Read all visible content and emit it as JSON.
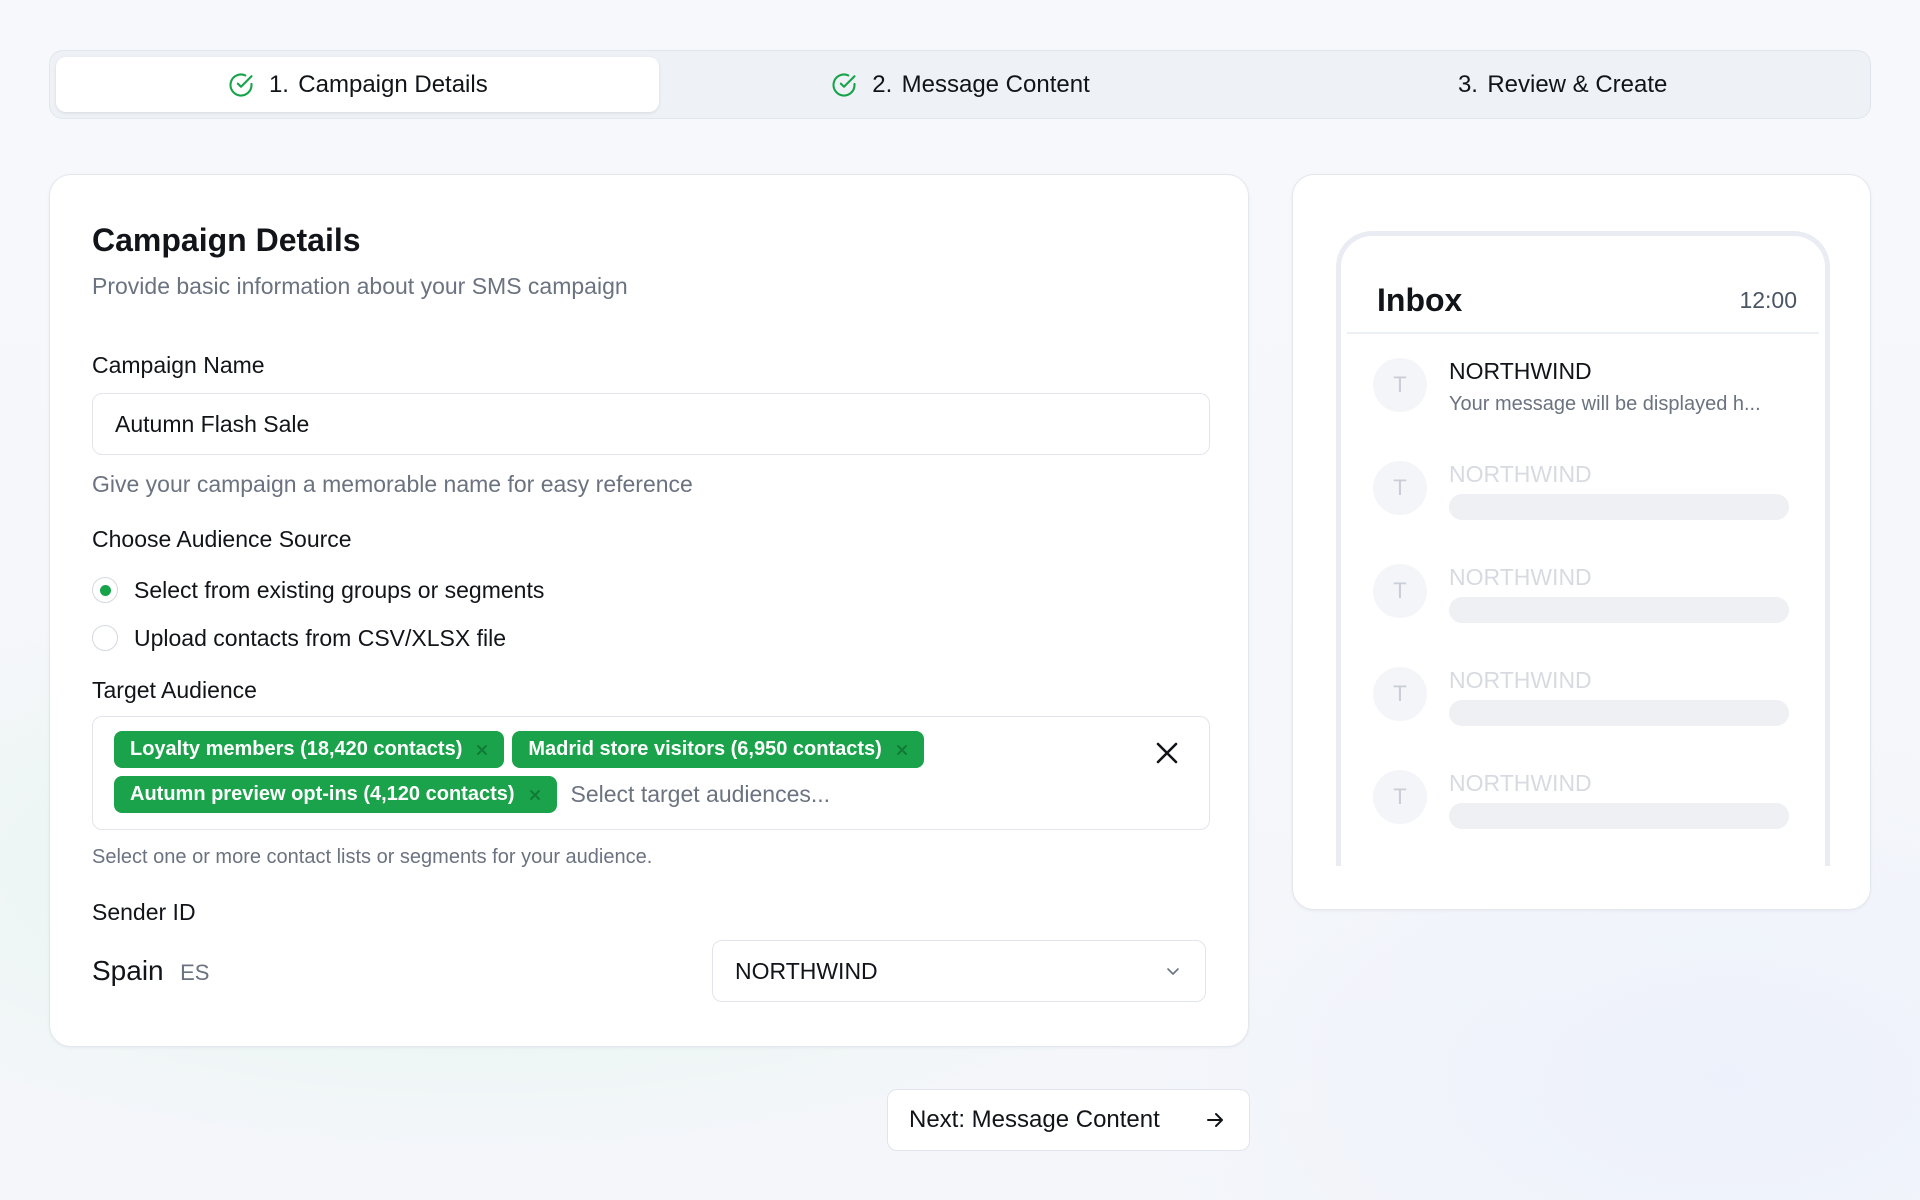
{
  "stepper": {
    "steps": [
      {
        "number": "1.",
        "label": "Campaign Details",
        "completed": true,
        "active": true
      },
      {
        "number": "2.",
        "label": "Message Content",
        "completed": true,
        "active": false
      },
      {
        "number": "3.",
        "label": "Review & Create",
        "completed": false,
        "active": false
      }
    ]
  },
  "details": {
    "title": "Campaign Details",
    "subtitle": "Provide basic information about your SMS campaign",
    "campaign_name": {
      "label": "Campaign Name",
      "value": "Autumn Flash Sale",
      "helper": "Give your campaign a memorable name for easy reference"
    },
    "audience_source": {
      "label": "Choose Audience Source",
      "options": [
        {
          "label": "Select from existing groups or segments",
          "selected": true
        },
        {
          "label": "Upload contacts from CSV/XLSX file",
          "selected": false
        }
      ]
    },
    "target_audience": {
      "label": "Target Audience",
      "tags": [
        "Loyalty members (18,420 contacts)",
        "Madrid store visitors (6,950 contacts)",
        "Autumn preview opt-ins (4,120 contacts)"
      ],
      "placeholder": "Select target audiences...",
      "helper": "Select one or more contact lists or segments for your audience."
    },
    "sender_id": {
      "label": "Sender ID",
      "country": "Spain",
      "country_code": "ES",
      "selected": "NORTHWIND"
    }
  },
  "preview": {
    "inbox_title": "Inbox",
    "time": "12:00",
    "messages": [
      {
        "avatar": "T",
        "sender": "NORTHWIND",
        "preview": "Your message will be displayed h..."
      },
      {
        "avatar": "T",
        "sender": "NORTHWIND"
      },
      {
        "avatar": "T",
        "sender": "NORTHWIND"
      },
      {
        "avatar": "T",
        "sender": "NORTHWIND"
      },
      {
        "avatar": "T",
        "sender": "NORTHWIND"
      }
    ]
  },
  "next_button": {
    "label": "Next: Message Content"
  },
  "colors": {
    "accent": "#16a34a",
    "tag_bg": "#1aa34a"
  }
}
